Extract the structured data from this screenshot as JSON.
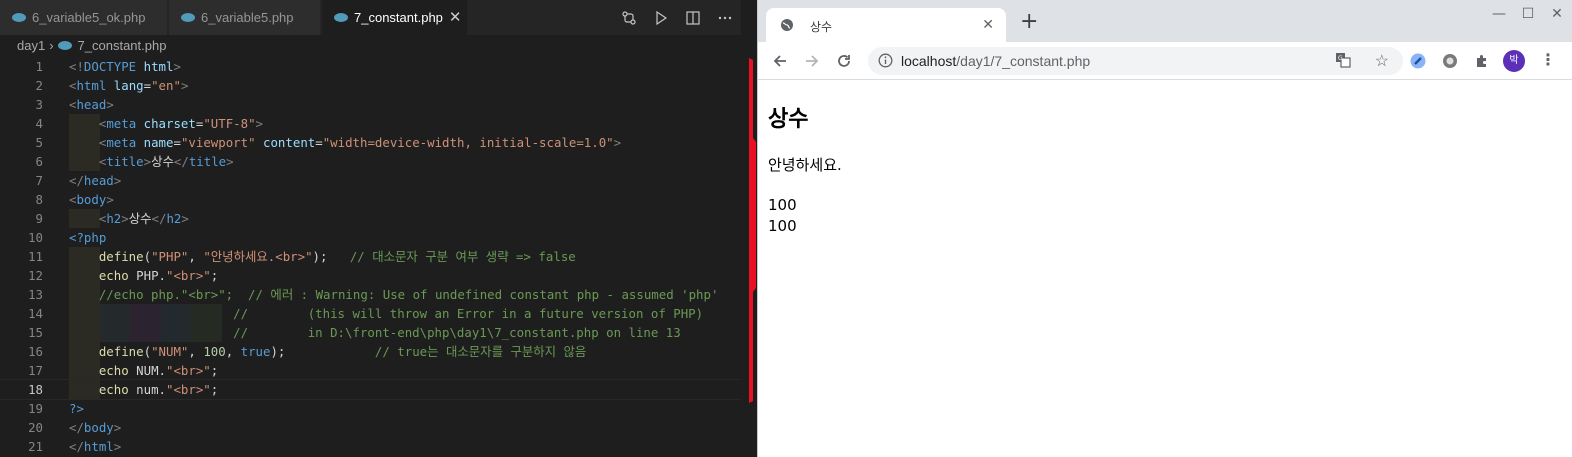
{
  "editor": {
    "tabs": [
      {
        "label": "6_variable5_ok.php",
        "active": false
      },
      {
        "label": "6_variable5.php",
        "active": false
      },
      {
        "label": "7_constant.php",
        "active": true
      }
    ],
    "breadcrumb": {
      "folder": "day1",
      "file": "7_constant.php"
    },
    "current_line": 18,
    "lines": [
      {
        "n": "1",
        "tokens": [
          [
            "br",
            "<!"
          ],
          [
            "tag",
            "DOCTYPE"
          ],
          [
            "txt",
            " "
          ],
          [
            "attr",
            "html"
          ],
          [
            "br",
            ">"
          ]
        ]
      },
      {
        "n": "2",
        "tokens": [
          [
            "br",
            "<"
          ],
          [
            "tag",
            "html"
          ],
          [
            "txt",
            " "
          ],
          [
            "attr",
            "lang"
          ],
          [
            "txt",
            "="
          ],
          [
            "str",
            "\"en\""
          ],
          [
            "br",
            ">"
          ]
        ]
      },
      {
        "n": "3",
        "tokens": [
          [
            "br",
            "<"
          ],
          [
            "tag",
            "head"
          ],
          [
            "br",
            ">"
          ]
        ]
      },
      {
        "n": "4",
        "tokens": [
          [
            "txt",
            "    "
          ],
          [
            "br",
            "<"
          ],
          [
            "tag",
            "meta"
          ],
          [
            "txt",
            " "
          ],
          [
            "attr",
            "charset"
          ],
          [
            "txt",
            "="
          ],
          [
            "str",
            "\"UTF-8\""
          ],
          [
            "br",
            ">"
          ]
        ]
      },
      {
        "n": "5",
        "tokens": [
          [
            "txt",
            "    "
          ],
          [
            "br",
            "<"
          ],
          [
            "tag",
            "meta"
          ],
          [
            "txt",
            " "
          ],
          [
            "attr",
            "name"
          ],
          [
            "txt",
            "="
          ],
          [
            "str",
            "\"viewport\""
          ],
          [
            "txt",
            " "
          ],
          [
            "attr",
            "content"
          ],
          [
            "txt",
            "="
          ],
          [
            "str",
            "\"width=device-width, initial-scale=1.0\""
          ],
          [
            "br",
            ">"
          ]
        ]
      },
      {
        "n": "6",
        "tokens": [
          [
            "txt",
            "    "
          ],
          [
            "br",
            "<"
          ],
          [
            "tag",
            "title"
          ],
          [
            "br",
            ">"
          ],
          [
            "txt",
            "상수"
          ],
          [
            "br",
            "</"
          ],
          [
            "tag",
            "title"
          ],
          [
            "br",
            ">"
          ]
        ]
      },
      {
        "n": "7",
        "tokens": [
          [
            "br",
            "</"
          ],
          [
            "tag",
            "head"
          ],
          [
            "br",
            ">"
          ]
        ]
      },
      {
        "n": "8",
        "tokens": [
          [
            "br",
            "<"
          ],
          [
            "tag",
            "body"
          ],
          [
            "br",
            ">"
          ]
        ]
      },
      {
        "n": "9",
        "tokens": [
          [
            "txt",
            "    "
          ],
          [
            "br",
            "<"
          ],
          [
            "tag",
            "h2"
          ],
          [
            "br",
            ">"
          ],
          [
            "txt",
            "상수"
          ],
          [
            "br",
            "</"
          ],
          [
            "tag",
            "h2"
          ],
          [
            "br",
            ">"
          ]
        ]
      },
      {
        "n": "10",
        "tokens": [
          [
            "php",
            "<?php"
          ]
        ]
      },
      {
        "n": "11",
        "tokens": [
          [
            "txt",
            "    "
          ],
          [
            "fn",
            "define"
          ],
          [
            "txt",
            "("
          ],
          [
            "str",
            "\"PHP\""
          ],
          [
            "txt",
            ", "
          ],
          [
            "str",
            "\"안녕하세요.<br>\""
          ],
          [
            "txt",
            ");   "
          ],
          [
            "com",
            "// 대소문자 구분 여부 생략 => false"
          ]
        ]
      },
      {
        "n": "12",
        "tokens": [
          [
            "txt",
            "    "
          ],
          [
            "fn",
            "echo"
          ],
          [
            "txt",
            " PHP."
          ],
          [
            "str",
            "\"<br>\""
          ],
          [
            "txt",
            ";"
          ]
        ]
      },
      {
        "n": "13",
        "tokens": [
          [
            "txt",
            "    "
          ],
          [
            "com",
            "//echo php.\"<br>\";  // 에러 : Warning: Use of undefined constant php - assumed 'php'"
          ]
        ]
      },
      {
        "n": "14",
        "tokens": [
          [
            "txt",
            "                      "
          ],
          [
            "com",
            "//        (this will throw an Error in a future version of PHP)"
          ]
        ]
      },
      {
        "n": "15",
        "tokens": [
          [
            "txt",
            "                      "
          ],
          [
            "com",
            "//        in D:\\front-end\\php\\day1\\7_constant.php on line 13"
          ]
        ]
      },
      {
        "n": "16",
        "tokens": [
          [
            "txt",
            "    "
          ],
          [
            "fn",
            "define"
          ],
          [
            "txt",
            "("
          ],
          [
            "str",
            "\"NUM\""
          ],
          [
            "txt",
            ", "
          ],
          [
            "num",
            "100"
          ],
          [
            "txt",
            ", "
          ],
          [
            "kw",
            "true"
          ],
          [
            "txt",
            ");            "
          ],
          [
            "com",
            "// true는 대소문자를 구분하지 않음"
          ]
        ]
      },
      {
        "n": "17",
        "tokens": [
          [
            "txt",
            "    "
          ],
          [
            "fn",
            "echo"
          ],
          [
            "txt",
            " NUM."
          ],
          [
            "str",
            "\"<br>\""
          ],
          [
            "txt",
            ";"
          ]
        ]
      },
      {
        "n": "18",
        "tokens": [
          [
            "txt",
            "    "
          ],
          [
            "fn",
            "echo"
          ],
          [
            "txt",
            " num."
          ],
          [
            "str",
            "\"<br>\""
          ],
          [
            "txt",
            ";"
          ]
        ]
      },
      {
        "n": "19",
        "tokens": [
          [
            "php",
            "?>"
          ]
        ]
      },
      {
        "n": "20",
        "tokens": [
          [
            "br",
            "</"
          ],
          [
            "tag",
            "body"
          ],
          [
            "br",
            ">"
          ]
        ]
      },
      {
        "n": "21",
        "tokens": [
          [
            "br",
            "</"
          ],
          [
            "tag",
            "html"
          ],
          [
            "br",
            ">"
          ]
        ]
      }
    ]
  },
  "browser": {
    "tab_title": "상수",
    "url_host": "localhost",
    "url_path": "/day1/7_constant.php",
    "profile_initial": "박",
    "page": {
      "heading": "상수",
      "line1": "안녕하세요.",
      "line2": "100",
      "line3": "100"
    }
  },
  "colors": {
    "editor_bg": "#1e1e1e",
    "accent_red": "#e81123",
    "profile": "#5b2fb8"
  }
}
